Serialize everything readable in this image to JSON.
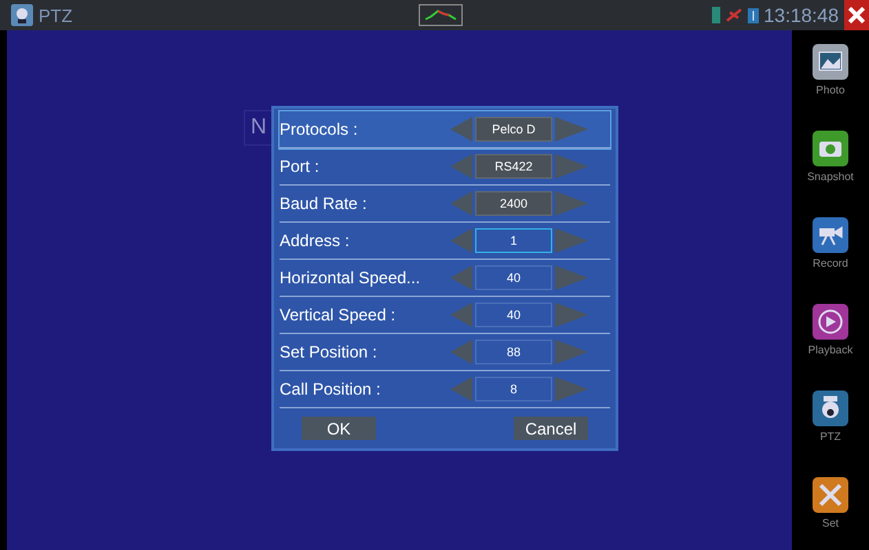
{
  "window": {
    "title": "PTZ",
    "time": "13:18:48"
  },
  "background_text": "N",
  "dialog": {
    "rows": [
      {
        "label": "Protocols :",
        "value": "Pelco D",
        "kind": "select",
        "selected": true,
        "focused": false
      },
      {
        "label": "Port :",
        "value": "RS422",
        "kind": "select",
        "selected": false,
        "focused": false
      },
      {
        "label": "Baud Rate :",
        "value": "2400",
        "kind": "select",
        "selected": false,
        "focused": false
      },
      {
        "label": "Address :",
        "value": "1",
        "kind": "input",
        "selected": false,
        "focused": true
      },
      {
        "label": "Horizontal Speed...",
        "value": "40",
        "kind": "input",
        "selected": false,
        "focused": false
      },
      {
        "label": "Vertical Speed :",
        "value": "40",
        "kind": "input",
        "selected": false,
        "focused": false
      },
      {
        "label": "Set Position :",
        "value": "88",
        "kind": "input",
        "selected": false,
        "focused": false
      },
      {
        "label": "Call Position :",
        "value": "8",
        "kind": "input",
        "selected": false,
        "focused": false
      }
    ],
    "buttons": [
      "OK",
      "Cancel"
    ]
  },
  "sidebar": {
    "items": [
      {
        "label": "Photo",
        "color": "#9aa3ad"
      },
      {
        "label": "Snapshot",
        "color": "#3f9a2c"
      },
      {
        "label": "Record",
        "color": "#2f6db8"
      },
      {
        "label": "Playback",
        "color": "#a0359a"
      },
      {
        "label": "PTZ",
        "color": "#2a6a9a"
      },
      {
        "label": "Set",
        "color": "#d07a20"
      }
    ]
  }
}
